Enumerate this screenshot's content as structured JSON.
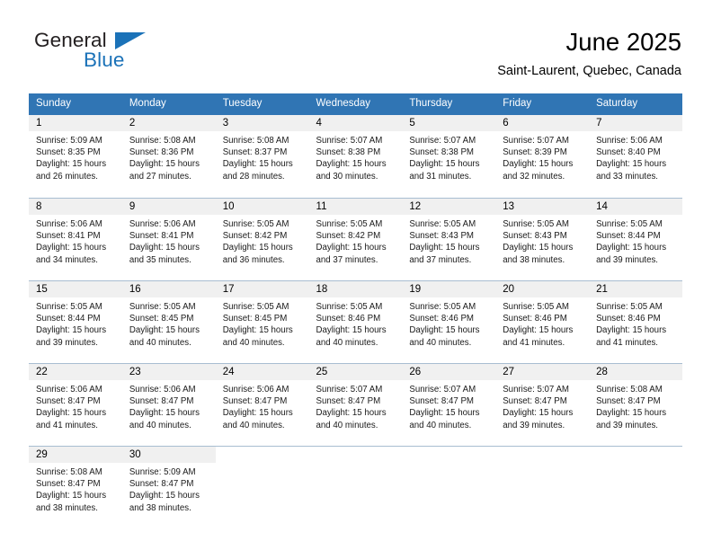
{
  "brand": {
    "line1": "General",
    "line2": "Blue",
    "flag_icon": "triangle-flag-icon",
    "accent_color": "#1b72b8"
  },
  "header": {
    "title": "June 2025",
    "subtitle": "Saint-Laurent, Quebec, Canada"
  },
  "theme": {
    "header_blue": "#3075b4",
    "daynum_band": "#f0f0f0",
    "row_divider": "#a8bdd1"
  },
  "calendar": {
    "weekday_headers": [
      "Sunday",
      "Monday",
      "Tuesday",
      "Wednesday",
      "Thursday",
      "Friday",
      "Saturday"
    ],
    "weeks": [
      [
        {
          "day": "1",
          "sunrise": "Sunrise: 5:09 AM",
          "sunset": "Sunset: 8:35 PM",
          "daylight1": "Daylight: 15 hours",
          "daylight2": "and 26 minutes."
        },
        {
          "day": "2",
          "sunrise": "Sunrise: 5:08 AM",
          "sunset": "Sunset: 8:36 PM",
          "daylight1": "Daylight: 15 hours",
          "daylight2": "and 27 minutes."
        },
        {
          "day": "3",
          "sunrise": "Sunrise: 5:08 AM",
          "sunset": "Sunset: 8:37 PM",
          "daylight1": "Daylight: 15 hours",
          "daylight2": "and 28 minutes."
        },
        {
          "day": "4",
          "sunrise": "Sunrise: 5:07 AM",
          "sunset": "Sunset: 8:38 PM",
          "daylight1": "Daylight: 15 hours",
          "daylight2": "and 30 minutes."
        },
        {
          "day": "5",
          "sunrise": "Sunrise: 5:07 AM",
          "sunset": "Sunset: 8:38 PM",
          "daylight1": "Daylight: 15 hours",
          "daylight2": "and 31 minutes."
        },
        {
          "day": "6",
          "sunrise": "Sunrise: 5:07 AM",
          "sunset": "Sunset: 8:39 PM",
          "daylight1": "Daylight: 15 hours",
          "daylight2": "and 32 minutes."
        },
        {
          "day": "7",
          "sunrise": "Sunrise: 5:06 AM",
          "sunset": "Sunset: 8:40 PM",
          "daylight1": "Daylight: 15 hours",
          "daylight2": "and 33 minutes."
        }
      ],
      [
        {
          "day": "8",
          "sunrise": "Sunrise: 5:06 AM",
          "sunset": "Sunset: 8:41 PM",
          "daylight1": "Daylight: 15 hours",
          "daylight2": "and 34 minutes."
        },
        {
          "day": "9",
          "sunrise": "Sunrise: 5:06 AM",
          "sunset": "Sunset: 8:41 PM",
          "daylight1": "Daylight: 15 hours",
          "daylight2": "and 35 minutes."
        },
        {
          "day": "10",
          "sunrise": "Sunrise: 5:05 AM",
          "sunset": "Sunset: 8:42 PM",
          "daylight1": "Daylight: 15 hours",
          "daylight2": "and 36 minutes."
        },
        {
          "day": "11",
          "sunrise": "Sunrise: 5:05 AM",
          "sunset": "Sunset: 8:42 PM",
          "daylight1": "Daylight: 15 hours",
          "daylight2": "and 37 minutes."
        },
        {
          "day": "12",
          "sunrise": "Sunrise: 5:05 AM",
          "sunset": "Sunset: 8:43 PM",
          "daylight1": "Daylight: 15 hours",
          "daylight2": "and 37 minutes."
        },
        {
          "day": "13",
          "sunrise": "Sunrise: 5:05 AM",
          "sunset": "Sunset: 8:43 PM",
          "daylight1": "Daylight: 15 hours",
          "daylight2": "and 38 minutes."
        },
        {
          "day": "14",
          "sunrise": "Sunrise: 5:05 AM",
          "sunset": "Sunset: 8:44 PM",
          "daylight1": "Daylight: 15 hours",
          "daylight2": "and 39 minutes."
        }
      ],
      [
        {
          "day": "15",
          "sunrise": "Sunrise: 5:05 AM",
          "sunset": "Sunset: 8:44 PM",
          "daylight1": "Daylight: 15 hours",
          "daylight2": "and 39 minutes."
        },
        {
          "day": "16",
          "sunrise": "Sunrise: 5:05 AM",
          "sunset": "Sunset: 8:45 PM",
          "daylight1": "Daylight: 15 hours",
          "daylight2": "and 40 minutes."
        },
        {
          "day": "17",
          "sunrise": "Sunrise: 5:05 AM",
          "sunset": "Sunset: 8:45 PM",
          "daylight1": "Daylight: 15 hours",
          "daylight2": "and 40 minutes."
        },
        {
          "day": "18",
          "sunrise": "Sunrise: 5:05 AM",
          "sunset": "Sunset: 8:46 PM",
          "daylight1": "Daylight: 15 hours",
          "daylight2": "and 40 minutes."
        },
        {
          "day": "19",
          "sunrise": "Sunrise: 5:05 AM",
          "sunset": "Sunset: 8:46 PM",
          "daylight1": "Daylight: 15 hours",
          "daylight2": "and 40 minutes."
        },
        {
          "day": "20",
          "sunrise": "Sunrise: 5:05 AM",
          "sunset": "Sunset: 8:46 PM",
          "daylight1": "Daylight: 15 hours",
          "daylight2": "and 41 minutes."
        },
        {
          "day": "21",
          "sunrise": "Sunrise: 5:05 AM",
          "sunset": "Sunset: 8:46 PM",
          "daylight1": "Daylight: 15 hours",
          "daylight2": "and 41 minutes."
        }
      ],
      [
        {
          "day": "22",
          "sunrise": "Sunrise: 5:06 AM",
          "sunset": "Sunset: 8:47 PM",
          "daylight1": "Daylight: 15 hours",
          "daylight2": "and 41 minutes."
        },
        {
          "day": "23",
          "sunrise": "Sunrise: 5:06 AM",
          "sunset": "Sunset: 8:47 PM",
          "daylight1": "Daylight: 15 hours",
          "daylight2": "and 40 minutes."
        },
        {
          "day": "24",
          "sunrise": "Sunrise: 5:06 AM",
          "sunset": "Sunset: 8:47 PM",
          "daylight1": "Daylight: 15 hours",
          "daylight2": "and 40 minutes."
        },
        {
          "day": "25",
          "sunrise": "Sunrise: 5:07 AM",
          "sunset": "Sunset: 8:47 PM",
          "daylight1": "Daylight: 15 hours",
          "daylight2": "and 40 minutes."
        },
        {
          "day": "26",
          "sunrise": "Sunrise: 5:07 AM",
          "sunset": "Sunset: 8:47 PM",
          "daylight1": "Daylight: 15 hours",
          "daylight2": "and 40 minutes."
        },
        {
          "day": "27",
          "sunrise": "Sunrise: 5:07 AM",
          "sunset": "Sunset: 8:47 PM",
          "daylight1": "Daylight: 15 hours",
          "daylight2": "and 39 minutes."
        },
        {
          "day": "28",
          "sunrise": "Sunrise: 5:08 AM",
          "sunset": "Sunset: 8:47 PM",
          "daylight1": "Daylight: 15 hours",
          "daylight2": "and 39 minutes."
        }
      ],
      [
        {
          "day": "29",
          "sunrise": "Sunrise: 5:08 AM",
          "sunset": "Sunset: 8:47 PM",
          "daylight1": "Daylight: 15 hours",
          "daylight2": "and 38 minutes."
        },
        {
          "day": "30",
          "sunrise": "Sunrise: 5:09 AM",
          "sunset": "Sunset: 8:47 PM",
          "daylight1": "Daylight: 15 hours",
          "daylight2": "and 38 minutes."
        },
        null,
        null,
        null,
        null,
        null
      ]
    ]
  }
}
